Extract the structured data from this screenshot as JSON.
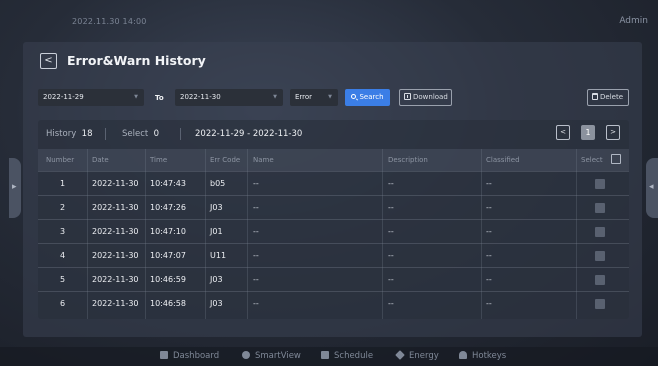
{
  "topbar": {
    "datetime": "2022.11.30  14:00",
    "user": "Admin"
  },
  "page": {
    "title": "Error&Warn History",
    "back_glyph": "<"
  },
  "filters": {
    "from_date": "2022-11-29",
    "to_label": "To",
    "to_date": "2022-11-30",
    "type": "Error",
    "search_label": "Search",
    "download_label": "Download",
    "delete_label": "Delete"
  },
  "summary": {
    "history_label": "History",
    "history_count": "18",
    "select_label": "Select",
    "select_count": "0",
    "range": "2022-11-29 - 2022-11-30"
  },
  "pager": {
    "prev": "<",
    "current": "1",
    "next": ">"
  },
  "table": {
    "columns": [
      "Number",
      "Date",
      "Time",
      "Err Code",
      "Name",
      "Description",
      "Classified",
      "Select"
    ],
    "rows": [
      [
        "1",
        "2022-11-30",
        "10:47:43",
        "b05",
        "--",
        "--",
        "--"
      ],
      [
        "2",
        "2022-11-30",
        "10:47:26",
        "J03",
        "--",
        "--",
        "--"
      ],
      [
        "3",
        "2022-11-30",
        "10:47:10",
        "J01",
        "--",
        "--",
        "--"
      ],
      [
        "4",
        "2022-11-30",
        "10:47:07",
        "U11",
        "--",
        "--",
        "--"
      ],
      [
        "5",
        "2022-11-30",
        "10:46:59",
        "J03",
        "--",
        "--",
        "--"
      ],
      [
        "6",
        "2022-11-30",
        "10:46:58",
        "J03",
        "--",
        "--",
        "--"
      ]
    ]
  },
  "nav": [
    {
      "label": "Dashboard",
      "icon": "dashboard-icon"
    },
    {
      "label": "SmartView",
      "icon": "smartview-icon"
    },
    {
      "label": "Schedule",
      "icon": "schedule-icon"
    },
    {
      "label": "Energy",
      "icon": "energy-icon"
    },
    {
      "label": "Hotkeys",
      "icon": "hotkeys-icon"
    }
  ],
  "colors": {
    "accent": "#3b7ee6",
    "panel": "#3a4252",
    "text": "#eef0f4"
  }
}
